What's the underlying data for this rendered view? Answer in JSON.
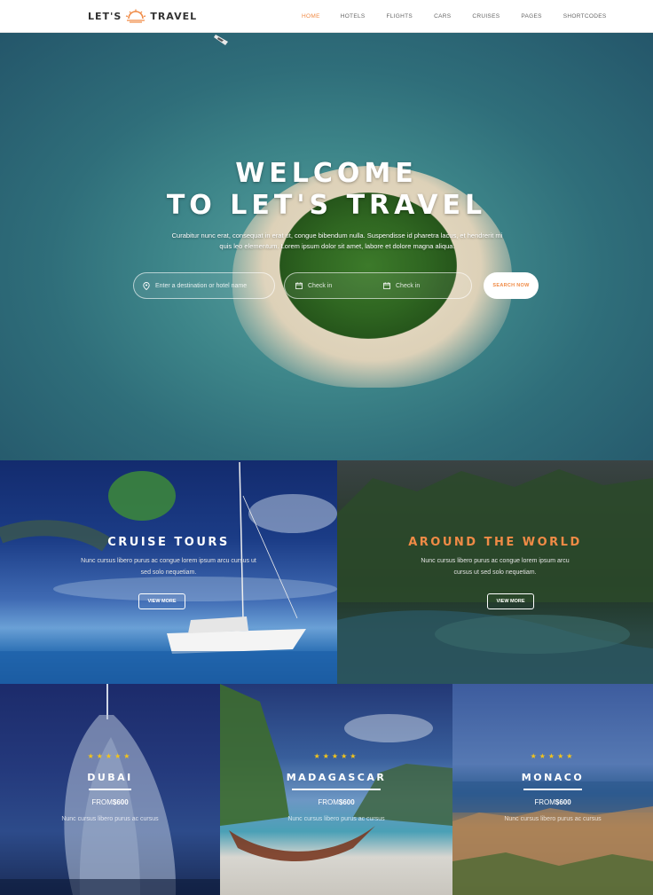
{
  "brand": {
    "name_left": "LET'S",
    "name_right": "TRAVEL",
    "accent": "#f08b46"
  },
  "nav": [
    {
      "label": "HOME",
      "active": true
    },
    {
      "label": "HOTELS"
    },
    {
      "label": "FLIGHTS"
    },
    {
      "label": "CARS"
    },
    {
      "label": "CRUISES"
    },
    {
      "label": "PAGES"
    },
    {
      "label": "SHORTCODES"
    }
  ],
  "hero": {
    "title_line1": "WELCOME",
    "title_line2": "TO LET'S TRAVEL",
    "description": "Curabitur nunc erat, consequat in erat ut, congue bibendum nulla. Suspendisse id pharetra lacus, et hendrerit mi quis leo elementum. Lorem ipsum dolor sit amet, labore et dolore magna aliqua.",
    "destination_placeholder": "Enter a destination or hotel name",
    "checkin_label": "Check in",
    "checkout_label": "Check in",
    "search_button": "SEARCH NOW"
  },
  "features": [
    {
      "title": "CRUISE TOURS",
      "title_color": "#ffffff",
      "text": "Nunc cursus libero purus ac congue lorem ipsum arcu cursus ut sed solo nequetiam.",
      "button": "VIEW MORE"
    },
    {
      "title": "AROUND THE WORLD",
      "title_color": "#f08b46",
      "text": "Nunc cursus libero purus ac congue lorem ipsum arcu cursus ut sed solo nequetiam.",
      "button": "VIEW MORE"
    }
  ],
  "destinations": [
    {
      "stars": "★★★★★",
      "rating": 5,
      "name": "DUBAI",
      "from_label": "FROM",
      "price": "$600",
      "text": "Nunc cursus libero purus ac cursus"
    },
    {
      "stars": "★★★★★",
      "rating": 5,
      "name": "MADAGASCAR",
      "from_label": "FROM",
      "price": "$600",
      "text": "Nunc cursus libero purus ac cursus"
    },
    {
      "stars": "★★★★★",
      "rating": 5,
      "name": "MONACO",
      "from_label": "FROM",
      "price": "$600",
      "text": "Nunc cursus libero purus ac cursus"
    }
  ],
  "icons": {
    "location": "map-pin-icon",
    "calendar": "calendar-icon",
    "logo": "sun-icon"
  }
}
